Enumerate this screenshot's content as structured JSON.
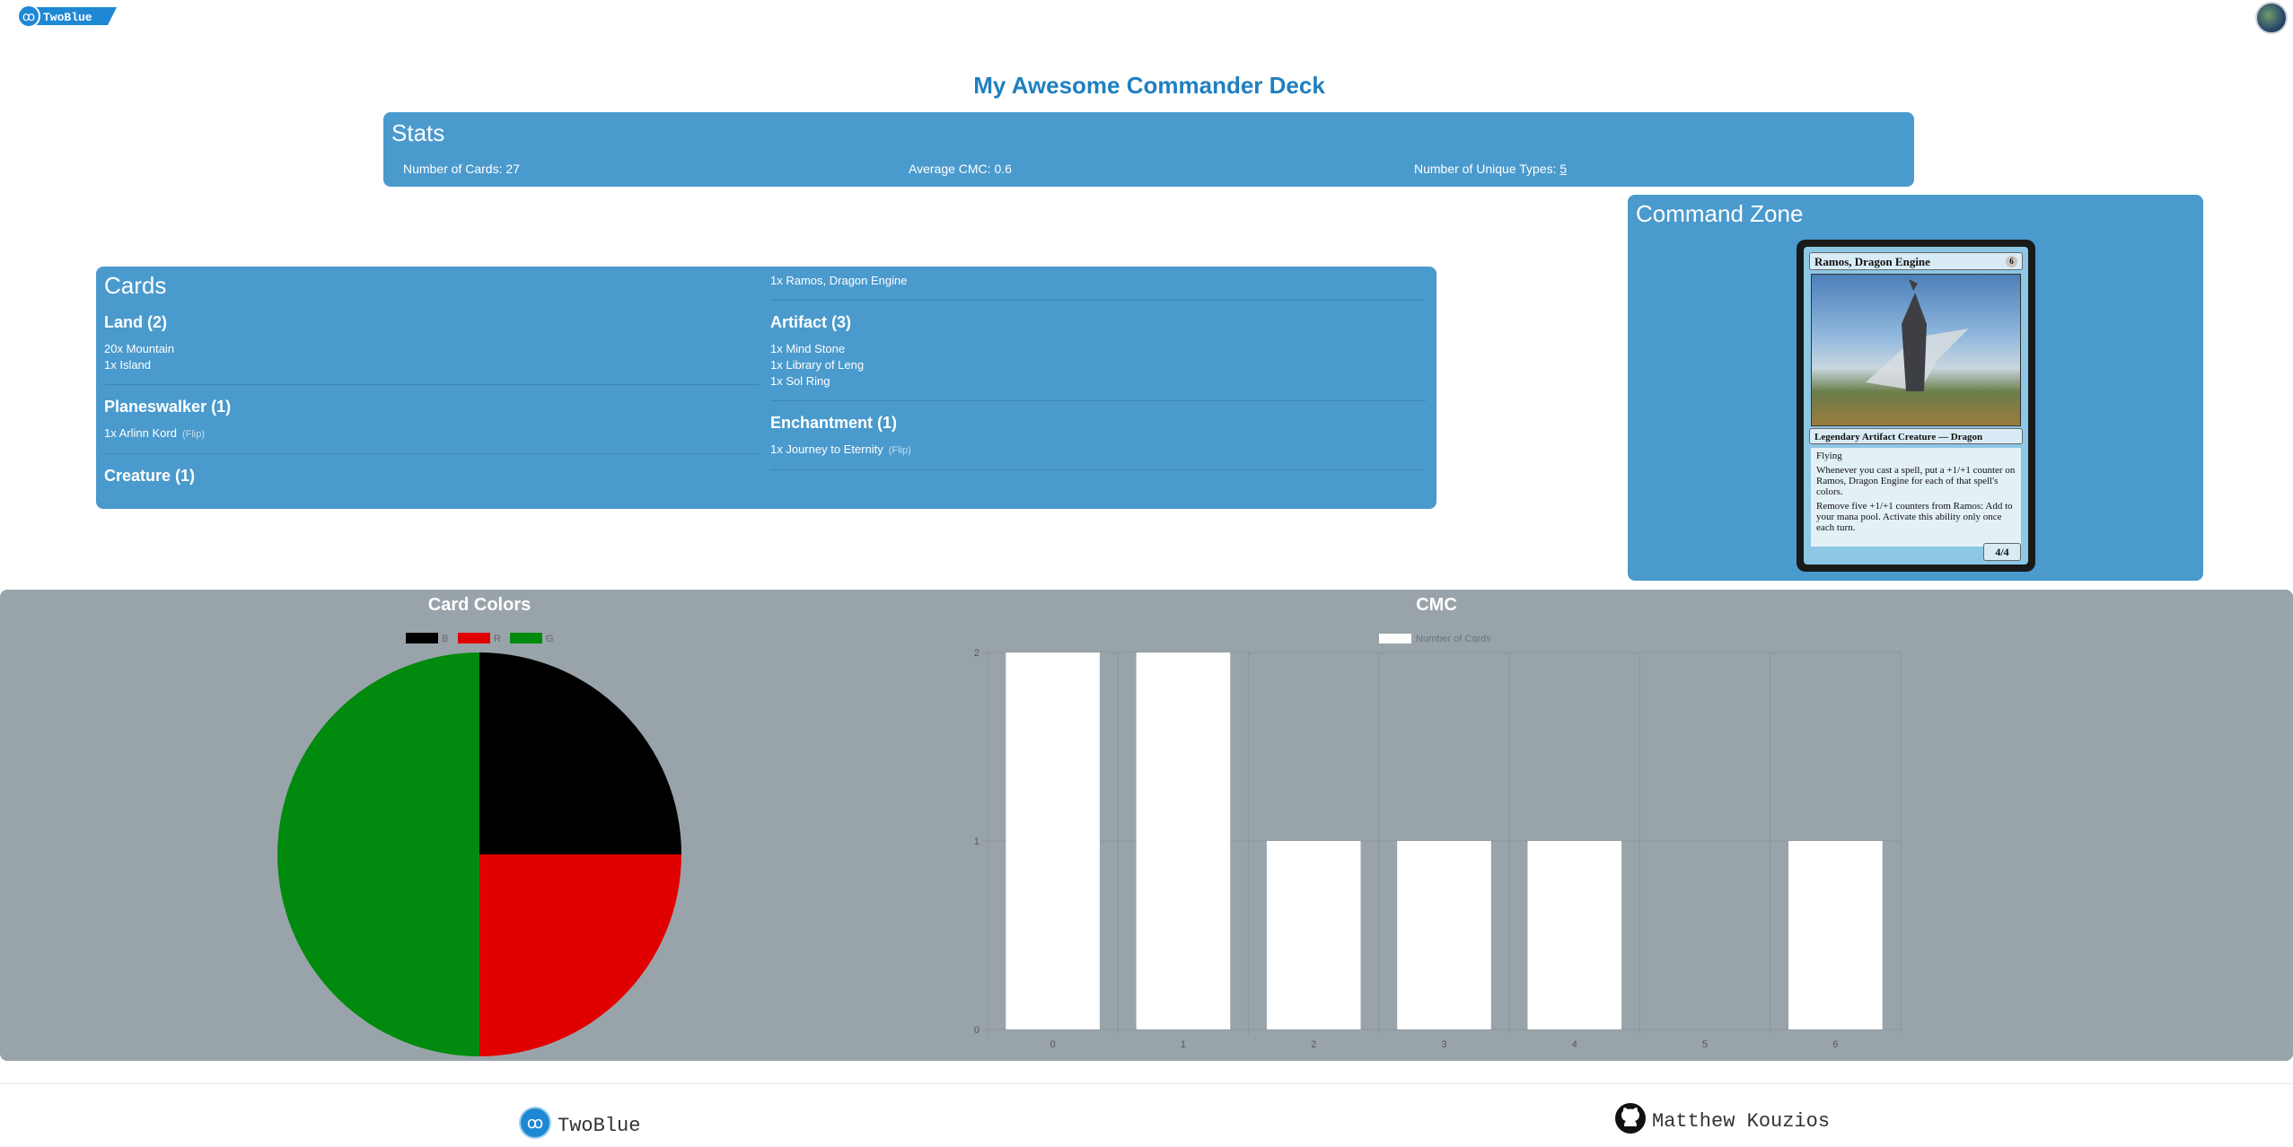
{
  "header": {
    "logo_text": "TwoBlue",
    "avatar": "user-avatar"
  },
  "deck": {
    "title": "My Awesome Commander Deck"
  },
  "stats": {
    "heading": "Stats",
    "num_cards": "Number of Cards: 27",
    "avg_cmc": "Average CMC: 0.6",
    "unique_types_label": "Number of Unique Types:",
    "unique_types_value": "5"
  },
  "cards": {
    "heading": "Cards",
    "groups": [
      {
        "title": "Land (2)",
        "items": [
          "20x Mountain",
          "1x Island"
        ]
      },
      {
        "title": "Planeswalker (1)",
        "items": [
          "1x Arlinn Kord"
        ],
        "flip": "(Flip)"
      },
      {
        "title": "Creature (1)",
        "items": [
          "1x Ramos, Dragon Engine"
        ]
      },
      {
        "title": "Artifact (3)",
        "items": [
          "1x Mind Stone",
          "1x Library of Leng",
          "1x Sol Ring"
        ]
      },
      {
        "title": "Enchantment (1)",
        "items": [
          "1x Journey to Eternity"
        ],
        "flip": "(Flip)"
      }
    ]
  },
  "command_zone": {
    "heading": "Command Zone",
    "card": {
      "name": "Ramos, Dragon Engine",
      "cost": "6",
      "type": "Legendary Artifact Creature — Dragon",
      "text1": "Flying",
      "text2": "Whenever you cast a spell, put a +1/+1 counter on Ramos, Dragon Engine for each of that spell's colors.",
      "text3": "Remove five +1/+1 counters from Ramos: Add to your mana pool. Activate this ability only once each turn.",
      "pt": "4/4"
    }
  },
  "charts": {
    "colors": "Card Colors",
    "cmc": "CMC"
  },
  "chart_data": [
    {
      "type": "pie",
      "title": "Card Colors",
      "categories": [
        "B",
        "R",
        "G"
      ],
      "values": [
        1,
        1,
        2
      ],
      "colors": [
        "#000000",
        "#e00000",
        "#008a0e"
      ],
      "legend": "top"
    },
    {
      "type": "bar",
      "title": "CMC",
      "categories": [
        "0",
        "1",
        "2",
        "3",
        "4",
        "5",
        "6"
      ],
      "series": [
        {
          "name": "Number of Cards",
          "values": [
            2,
            2,
            1,
            1,
            1,
            0,
            1
          ]
        }
      ],
      "ylim": [
        0,
        2
      ],
      "yticks": [
        "0",
        "1",
        "2"
      ],
      "grid": true,
      "legend": "top",
      "bar_color": "#ffffff"
    }
  ],
  "footer": {
    "left": "TwoBlue",
    "right": "Matthew Kouzios"
  }
}
